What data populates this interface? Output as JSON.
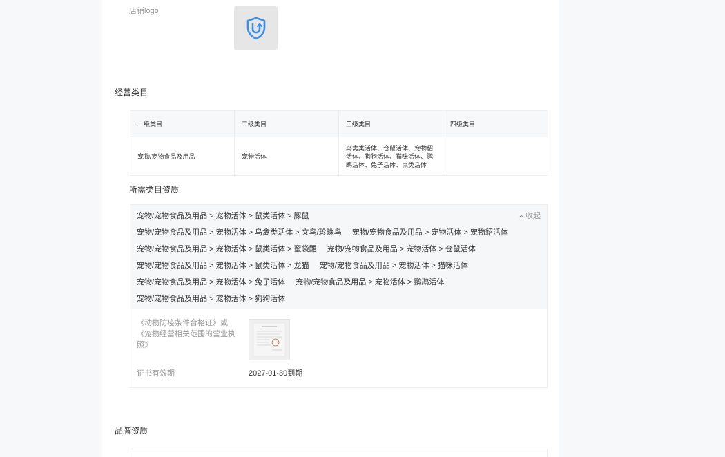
{
  "shop_logo": {
    "label": "店铺logo"
  },
  "business_category": {
    "title": "经营类目",
    "columns": [
      "一级类目",
      "二级类目",
      "三级类目",
      "四级类目"
    ],
    "rows": [
      [
        "宠物/宠物食品及用品",
        "宠物活体",
        "鸟禽类活体、仓鼠活体、宠物貂活体、狗狗活体、猫咪活体、鹦鹉活体、兔子活体、鼠类活体",
        ""
      ]
    ]
  },
  "required_qualifications": {
    "title": "所需类目资质",
    "collapse_label": "收起",
    "path_rows": [
      [
        "宠物/宠物食品及用品 > 宠物活体 > 鼠类活体 > 豚鼠"
      ],
      [
        "宠物/宠物食品及用品 > 宠物活体 > 鸟禽类活体 > 文鸟/珍珠鸟",
        "宠物/宠物食品及用品 > 宠物活体 > 宠物貂活体"
      ],
      [
        "宠物/宠物食品及用品 > 宠物活体 > 鼠类活体 > 蜜袋鼯",
        "宠物/宠物食品及用品 > 宠物活体 > 仓鼠活体"
      ],
      [
        "宠物/宠物食品及用品 > 宠物活体 > 鼠类活体 > 龙猫",
        "宠物/宠物食品及用品 > 宠物活体 > 猫咪活体"
      ],
      [
        "宠物/宠物食品及用品 > 宠物活体 > 兔子活体",
        "宠物/宠物食品及用品 > 宠物活体 > 鹦鹉活体"
      ],
      [
        "宠物/宠物食品及用品 > 宠物活体 > 狗狗活体"
      ]
    ],
    "certificate": {
      "name": "《动物防疫条件合格证》或《宠物经营相关范围的营业执照》",
      "validity_label": "证书有效期",
      "validity_value": "2027-01-30到期"
    }
  },
  "brand_qualification": {
    "title": "品牌资质"
  },
  "icons": {
    "shop_logo": "shield-logo-icon",
    "collapse": "chevron-up-icon",
    "certificate": "certificate-thumbnail"
  },
  "colors": {
    "accent": "#3d8fe6",
    "text_primary": "#333333",
    "text_secondary": "#999999",
    "panel_bg": "#ffffff",
    "page_bg": "#f7f8fa",
    "list_bg": "#f6f7f9",
    "border": "#edeef0"
  }
}
